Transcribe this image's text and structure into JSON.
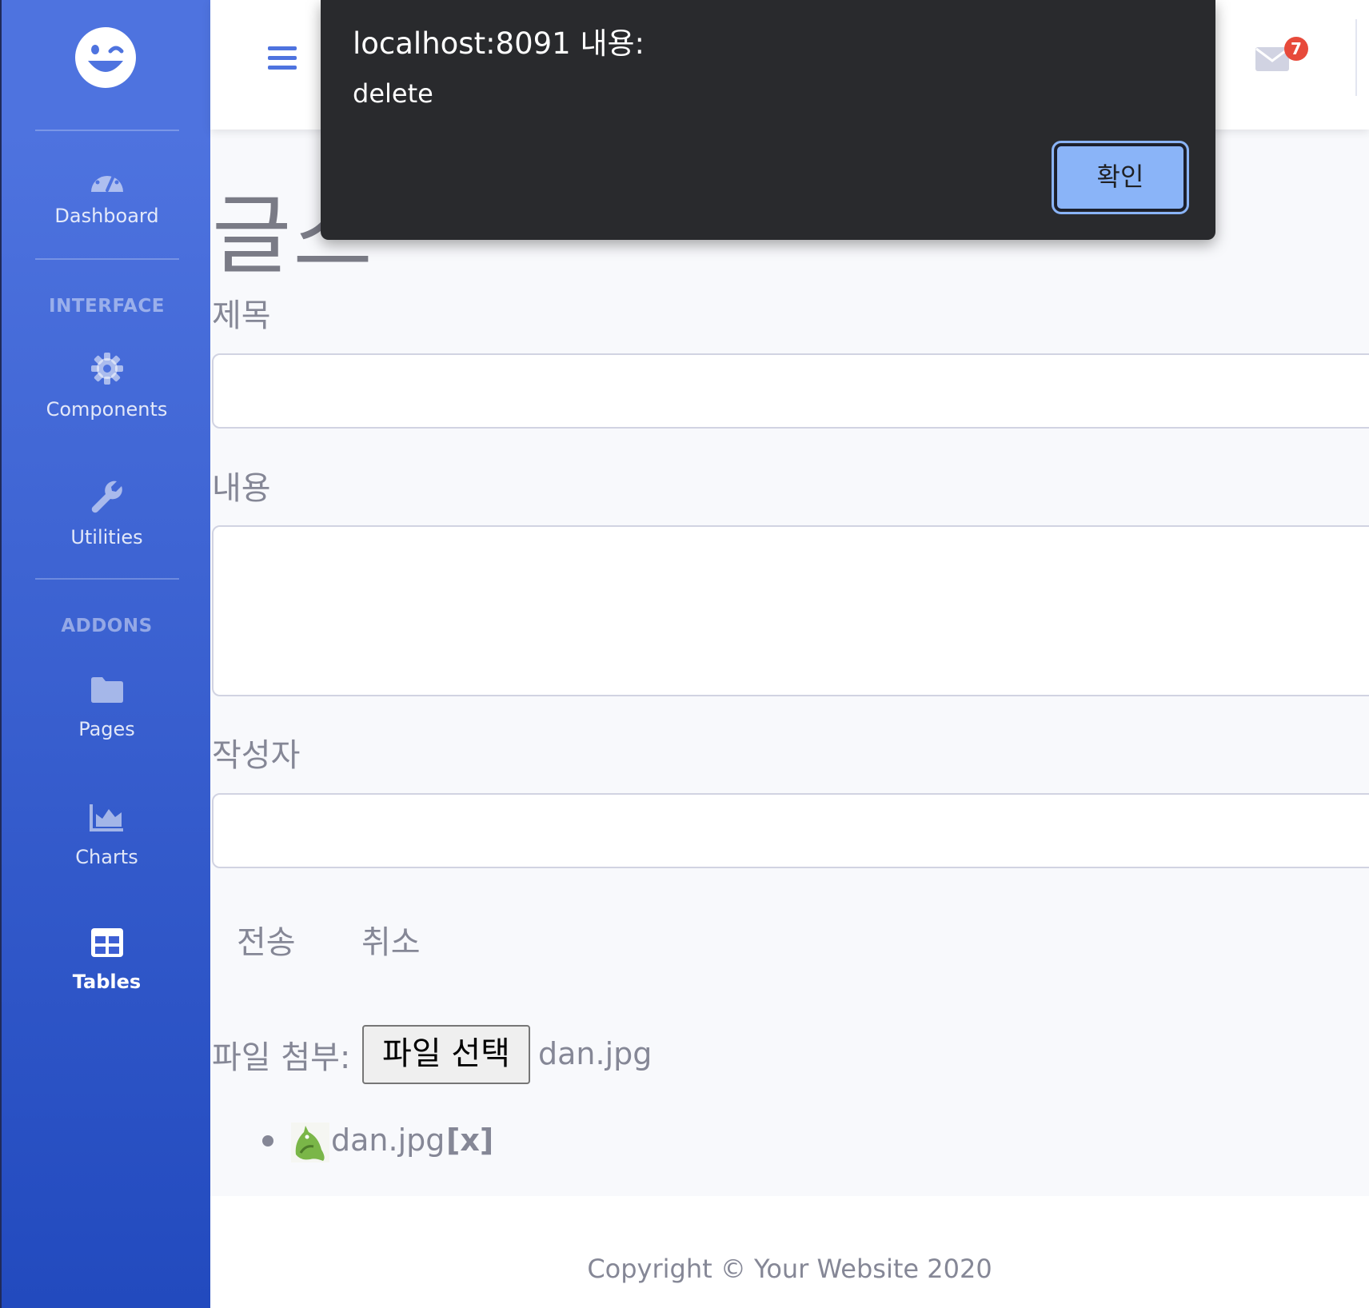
{
  "sidebar": {
    "headings": {
      "interface": "INTERFACE",
      "addons": "ADDONS"
    },
    "items": [
      {
        "label": "Dashboard",
        "icon": "tachometer-icon"
      },
      {
        "label": "Components",
        "icon": "gear-icon"
      },
      {
        "label": "Utilities",
        "icon": "wrench-icon"
      },
      {
        "label": "Pages",
        "icon": "folder-icon"
      },
      {
        "label": "Charts",
        "icon": "area-chart-icon"
      },
      {
        "label": "Tables",
        "icon": "table-icon",
        "active": true
      }
    ]
  },
  "topbar": {
    "messages_badge": "7"
  },
  "form": {
    "title_partial": "글스",
    "labels": {
      "title": "제목",
      "content": "내용",
      "author": "작성자"
    },
    "buttons": {
      "submit": "전송",
      "cancel": "취소"
    },
    "file": {
      "label": "파일 첨부:",
      "choose_button": "파일 선택",
      "chosen_name": "dan.jpg"
    },
    "attachments": [
      {
        "name": "dan.jpg",
        "remove": "[x]"
      }
    ]
  },
  "footer": {
    "text": "Copyright © Your Website 2020"
  },
  "dialog": {
    "title": "localhost:8091 내용:",
    "message": "delete",
    "ok_label": "확인"
  },
  "colors": {
    "sidebar_top": "#4e73df",
    "sidebar_bottom": "#224abe",
    "badge": "#e74a3b",
    "dialog_bg": "#292a2d",
    "dialog_button": "#8ab4f8"
  }
}
